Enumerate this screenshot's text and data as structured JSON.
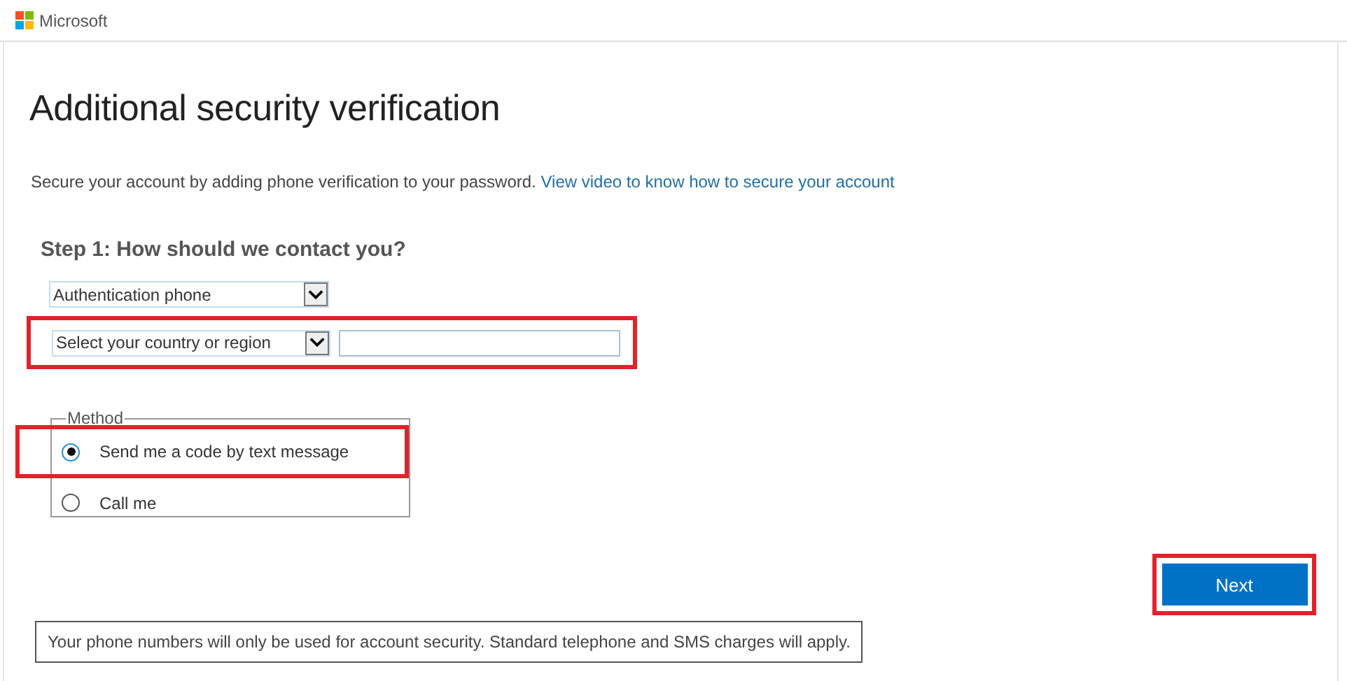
{
  "header": {
    "brand": "Microsoft"
  },
  "title": "Additional security verification",
  "intro": {
    "text": "Secure your account by adding phone verification to your password.",
    "link": "View video to know how to secure your account"
  },
  "step": {
    "heading": "Step 1: How should we contact you?",
    "contact_type": {
      "value": "Authentication phone"
    },
    "country": {
      "value": "Select your country or region",
      "highlighted": true
    },
    "method": {
      "legend": "Method",
      "options": [
        {
          "label": "Send me a code by text message",
          "selected": true,
          "highlighted": true
        },
        {
          "label": "Call me",
          "selected": false,
          "highlighted": false
        }
      ]
    }
  },
  "next_button": {
    "label": "Next",
    "highlighted": true
  },
  "note": "Your phone numbers will only be used for account security. Standard telephone and SMS charges will apply."
}
